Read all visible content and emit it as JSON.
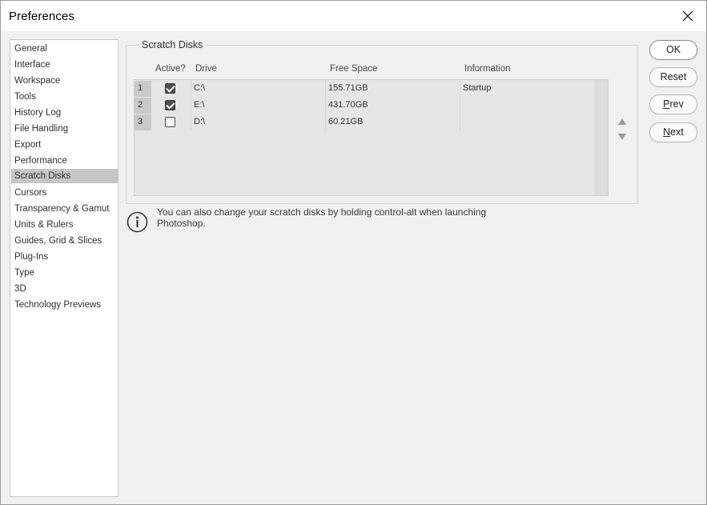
{
  "window": {
    "title": "Preferences",
    "close_icon": "close-icon"
  },
  "sidebar": {
    "items": [
      {
        "label": "General"
      },
      {
        "label": "Interface"
      },
      {
        "label": "Workspace"
      },
      {
        "label": "Tools"
      },
      {
        "label": "History Log"
      },
      {
        "label": "File Handling"
      },
      {
        "label": "Export"
      },
      {
        "label": "Performance"
      },
      {
        "label": "Scratch Disks",
        "selected": true
      },
      {
        "label": "Cursors"
      },
      {
        "label": "Transparency & Gamut"
      },
      {
        "label": "Units & Rulers"
      },
      {
        "label": "Guides, Grid & Slices"
      },
      {
        "label": "Plug-Ins"
      },
      {
        "label": "Type"
      },
      {
        "label": "3D"
      },
      {
        "label": "Technology Previews"
      }
    ]
  },
  "scratch_disks": {
    "group_title": "Scratch Disks",
    "columns": {
      "active": "Active?",
      "drive": "Drive",
      "free_space": "Free Space",
      "information": "Information"
    },
    "rows": [
      {
        "num": "1",
        "active": true,
        "drive": "C:\\",
        "free_space": "155.71GB",
        "information": "Startup"
      },
      {
        "num": "2",
        "active": true,
        "drive": "E:\\",
        "free_space": "431.70GB",
        "information": ""
      },
      {
        "num": "3",
        "active": false,
        "drive": "D:\\",
        "free_space": "60.21GB",
        "information": ""
      }
    ],
    "move_up_icon": "triangle-up-icon",
    "move_down_icon": "triangle-down-icon"
  },
  "info": {
    "icon": "info-icon",
    "text_line1": "You can also change your scratch disks by holding control-alt when launching",
    "text_line2": "Photoshop."
  },
  "buttons": {
    "ok": "OK",
    "reset": "Reset",
    "prev_u": "P",
    "prev_rest": "rev",
    "next_u": "N",
    "next_rest": "ext"
  },
  "colors": {
    "selected_bg": "#c6c6c6",
    "dialog_bg": "#f0f0f0",
    "checkbox_checked": "#4f4f4f"
  }
}
